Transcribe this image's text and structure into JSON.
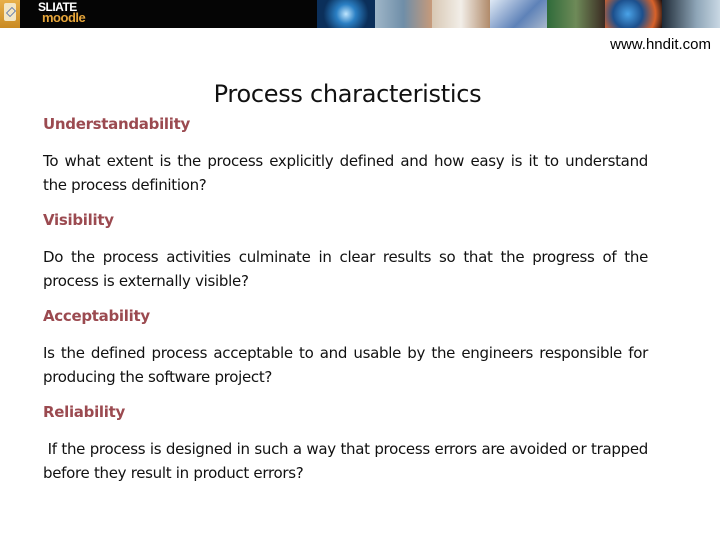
{
  "banner": {
    "logo_line1": "SLIATE",
    "logo_line2": "moodle",
    "photos": [
      "globe-photo",
      "touchscreen-photo",
      "students-photo",
      "circuit-photo",
      "classroom-photo",
      "earth-photo",
      "eye-photo"
    ]
  },
  "url": "www.hndit.com",
  "title": "Process characteristics",
  "sections": [
    {
      "heading": "Understandability",
      "text": "To what extent is the process explicitly defined and how easy is it to understand the process definition?"
    },
    {
      "heading": "Visibility",
      "text": "Do the process activities culminate in clear results so that the progress of the process is externally visible?"
    },
    {
      "heading": "Acceptability",
      "text": "Is the defined process acceptable to and usable by the engineers responsible for producing the software project?"
    },
    {
      "heading": "Reliability",
      "text": " If the process is designed in such a way that process errors are avoided or trapped before they result in product errors?"
    }
  ],
  "colors": {
    "heading": "#9b4a50",
    "banner_bg": "#050505",
    "logo_accent": "#e6a53a"
  }
}
